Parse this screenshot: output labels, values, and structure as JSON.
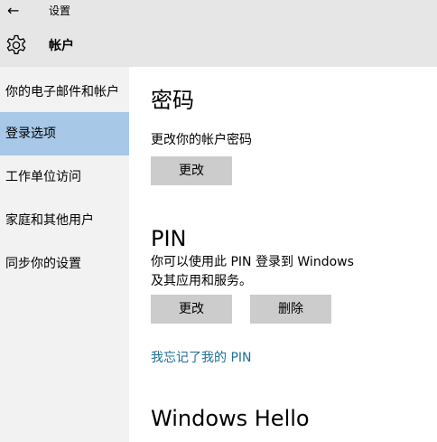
{
  "titlebar": {
    "back_icon": "back-arrow-icon",
    "title": "设置"
  },
  "header": {
    "icon": "gear-icon",
    "title": "帐户"
  },
  "sidebar": {
    "items": [
      {
        "label": "你的电子邮件和帐户",
        "selected": false
      },
      {
        "label": "登录选项",
        "selected": true
      },
      {
        "label": "工作单位访问",
        "selected": false
      },
      {
        "label": "家庭和其他用户",
        "selected": false
      },
      {
        "label": "同步你的设置",
        "selected": false
      }
    ]
  },
  "main": {
    "password": {
      "title": "密码",
      "description": "更改你的帐户密码",
      "change_button": "更改"
    },
    "pin": {
      "title": "PIN",
      "description_line1": "你可以使用此 PIN 登录到 Windows",
      "description_line2": "及其应用和服务。",
      "change_button": "更改",
      "delete_button": "删除",
      "forgot_link": "我忘记了我的 PIN"
    },
    "hello": {
      "title": "Windows Hello"
    }
  },
  "colors": {
    "header_bg": "#e6e6e6",
    "sidebar_bg": "#f2f2f2",
    "selected_bg": "#a7c8e7",
    "button_bg": "#cccccc",
    "link": "#1f6e96"
  }
}
